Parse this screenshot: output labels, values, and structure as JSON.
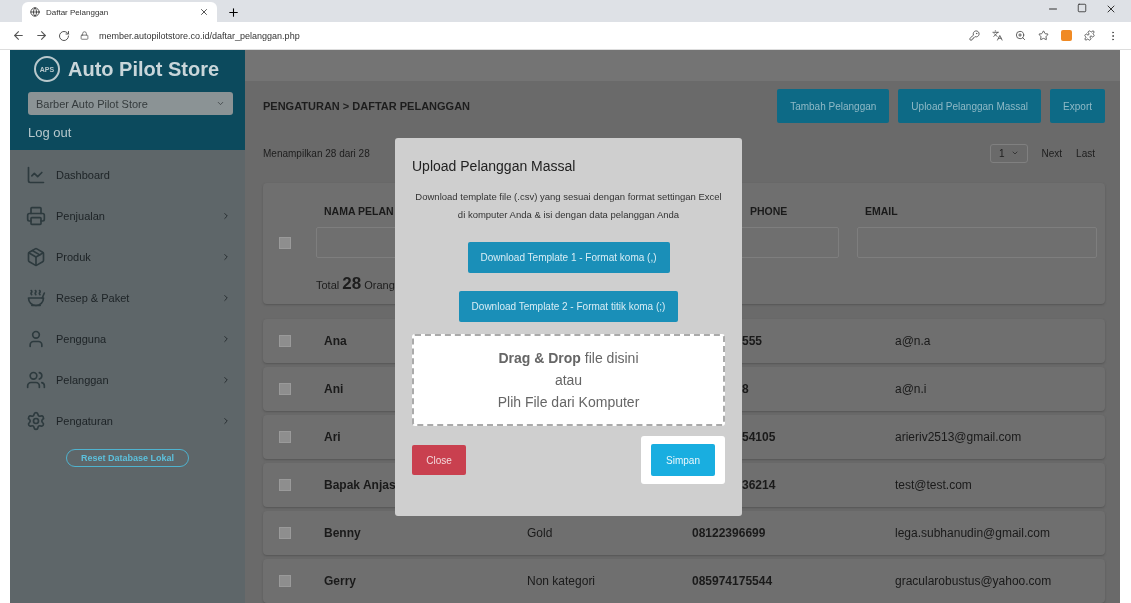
{
  "browser": {
    "tab_title": "Daftar Pelanggan",
    "url": "member.autopilotstore.co.id/daftar_pelanggan.php"
  },
  "sidebar": {
    "brand": "Auto Pilot Store",
    "logo_text": "APS",
    "store_select": "Barber Auto Pilot Store",
    "logout": "Log out",
    "menu": [
      {
        "label": "Dashboard",
        "has_submenu": false
      },
      {
        "label": "Penjualan",
        "has_submenu": true
      },
      {
        "label": "Produk",
        "has_submenu": true
      },
      {
        "label": "Resep & Paket",
        "has_submenu": true
      },
      {
        "label": "Pengguna",
        "has_submenu": true
      },
      {
        "label": "Pelanggan",
        "has_submenu": true
      },
      {
        "label": "Pengaturan",
        "has_submenu": true
      }
    ],
    "reset_button": "Reset Database Lokal"
  },
  "main": {
    "breadcrumb": "PENGATURAN > DAFTAR PELANGGAN",
    "actions": [
      "Tambah Pelanggan",
      "Upload Pelanggan Massal",
      "Export"
    ],
    "showing": "Menampilkan 28 dari 28",
    "pagination": {
      "page": "1",
      "next": "Next",
      "last": "Last"
    },
    "table": {
      "columns": [
        {
          "label": "NAMA PELAN",
          "kind": "name",
          "covered": false
        },
        {
          "label": "PHONE",
          "kind": "phone",
          "covered": true
        },
        {
          "label": "EMAIL",
          "kind": "email",
          "covered": false
        }
      ],
      "filter_checked": false,
      "total_prefix": "Total",
      "total_count": "28",
      "total_suffix": "Orang",
      "rows": [
        {
          "name": "Ana",
          "phone": "555",
          "email": "a@n.a",
          "covered": true,
          "checked": false
        },
        {
          "name": "Ani",
          "phone": "8",
          "email": "a@n.i",
          "covered": true,
          "checked": false
        },
        {
          "name": "Ari",
          "phone": "54105",
          "email": "arieriv2513@gmail.com",
          "covered": true,
          "checked": false
        },
        {
          "name": "Bapak Anjas",
          "phone": "36214",
          "email": "test@test.com",
          "covered": true,
          "checked": false
        },
        {
          "name": "Benny",
          "category": "Gold",
          "phone": "08122396699",
          "email": "lega.subhanudin@gmail.com",
          "covered": false,
          "checked": false
        },
        {
          "name": "Gerry",
          "category": "Non kategori",
          "phone": "085974175544",
          "email": "gracularobustus@yahoo.com",
          "covered": false,
          "checked": false
        }
      ]
    }
  },
  "modal": {
    "title": "Upload Pelanggan Massal",
    "description": "Download template file (.csv) yang sesuai dengan format settingan Excel di komputer Anda & isi dengan data pelanggan Anda",
    "downloads": [
      "Download Template 1 - Format koma (,)",
      "Download Template 2 - Format titik koma (;)"
    ],
    "dropzone": {
      "lead": "**Drag & Drop** file disini",
      "or": "atau",
      "pick": "Plih File dari Komputer"
    },
    "close": "Close",
    "save": "Simpan",
    "save_highlighted": true
  }
}
